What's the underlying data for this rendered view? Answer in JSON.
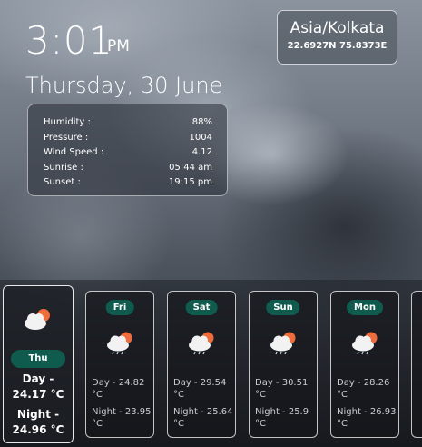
{
  "clock": {
    "time": "3:01",
    "ampm": "PM",
    "date": "Thursday, 30 June"
  },
  "location": {
    "timezone": "Asia/Kolkata",
    "coords": "22.6927N 75.8373E"
  },
  "details": [
    {
      "label": "Humidity :",
      "value": "88%"
    },
    {
      "label": "Pressure :",
      "value": "1004"
    },
    {
      "label": "Wind Speed :",
      "value": "4.12"
    },
    {
      "label": "Sunrise :",
      "value": "05:44 am"
    },
    {
      "label": "Sunset :",
      "value": "19:15 pm"
    }
  ],
  "today": {
    "day": "Thu",
    "day_temp_label": "Day -",
    "day_temp": "24.17 °C",
    "night_temp_label": "Night -",
    "night_temp": "24.96 °C",
    "icon": "partly-cloudy-icon"
  },
  "forecast": [
    {
      "day": "Fri",
      "day_temp": "Day - 24.82 °C",
      "night_temp": "Night - 23.95 °C",
      "icon": "rain-icon"
    },
    {
      "day": "Sat",
      "day_temp": "Day - 29.54 °C",
      "night_temp": "Night - 25.64 °C",
      "icon": "rain-icon"
    },
    {
      "day": "Sun",
      "day_temp": "Day - 30.51 °C",
      "night_temp": "Night - 25.9 °C",
      "icon": "rain-icon"
    },
    {
      "day": "Mon",
      "day_temp": "Day - 28.26 °C",
      "night_temp": "Night - 26.93 °C",
      "icon": "rain-icon"
    }
  ],
  "colors": {
    "pill": "#0f5c4e",
    "sun": "#f26b3a"
  }
}
